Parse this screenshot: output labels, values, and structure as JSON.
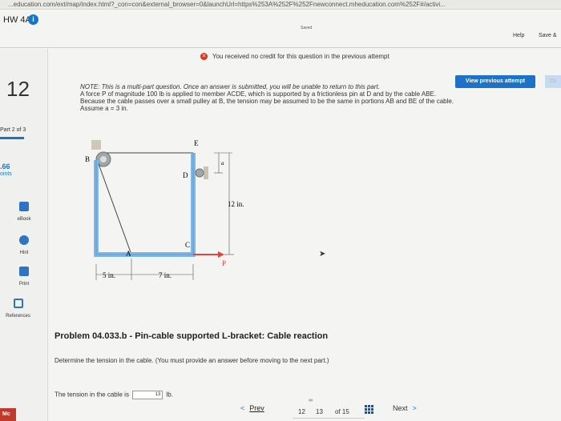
{
  "browser": {
    "url": "...education.com/ext/map/index.html?_con=con&external_browser=0&launchUrl=https%253A%252F%252Fnewconnect.mheducation.com%252F#/activi..."
  },
  "header": {
    "title": "HW 4A",
    "saved_label": "Saved",
    "help_label": "Help",
    "save_label": "Save &"
  },
  "sidebar": {
    "question_number": "12",
    "part_label": "Part 2 of 3",
    "points_value": ".66",
    "points_label": "oints",
    "tools": [
      {
        "label": "eBook",
        "icon": "ebook-icon"
      },
      {
        "label": "Hint",
        "icon": "hint-icon"
      },
      {
        "label": "Print",
        "icon": "print-icon"
      },
      {
        "label": "References",
        "icon": "references-icon"
      }
    ]
  },
  "notice": {
    "text": "You received no credit for this question in the previous attempt"
  },
  "view_previous_label": "View previous attempt",
  "right_tab_label": "Ch",
  "note": {
    "line1": "NOTE: This is a multi-part question. Once an answer is submitted, you will be unable to return to this part.",
    "line2": "A force P of magnitude 100 lb is applied to member ACDE, which is supported by a frictionless pin at D and by the cable ABE. Because the cable passes over a small pulley at B, the tension may be assumed to be the same in portions AB and BE of the cable. Assume a = 3 in."
  },
  "figure": {
    "labels": {
      "B": "B",
      "E": "E",
      "D": "D",
      "a": "a",
      "A": "A",
      "C": "C",
      "P": "P",
      "dim_5": "5 in.",
      "dim_7": "7 in.",
      "dim_12": "12 in."
    }
  },
  "problem": {
    "title": "Problem 04.033.b - Pin-cable supported L-bracket: Cable reaction",
    "description": "Determine the tension in the cable. (You must provide an answer before moving to the next part.)",
    "answer_prefix": "The tension in the cable is",
    "answer_value": "13",
    "answer_unit": "lb."
  },
  "footer": {
    "bottom_left": "Mc",
    "prev_label": "Prev",
    "page_current_a": "12",
    "page_current_b": "13",
    "page_total": "of 15",
    "next_label": "Next"
  },
  "colors": {
    "accent": "#1577c9",
    "member": "#7fb7e6",
    "force": "#e2463a",
    "error": "#d4341c"
  }
}
